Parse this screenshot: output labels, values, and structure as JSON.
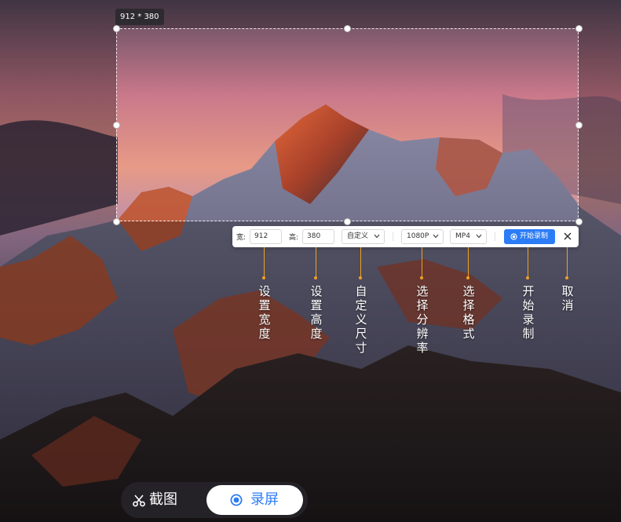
{
  "selection": {
    "size_label": "912 * 380"
  },
  "toolbar": {
    "width_label": "宽:",
    "width_value": "912",
    "height_label": "高:",
    "height_value": "380",
    "custom_label": "自定义",
    "resolution_value": "1080P",
    "format_value": "MP4",
    "record_label": "开始录制",
    "close_icon": "close-icon",
    "accent": "#2b7cf6"
  },
  "annotations": {
    "set_width": "设置宽度",
    "set_height": "设置高度",
    "custom_size": "自定义尺寸",
    "select_resolution": "选择分辨率",
    "select_format": "选择格式",
    "start_record": "开始录制",
    "cancel": "取消",
    "line_color": "#f0a020"
  },
  "mode_switch": {
    "screenshot_label": "截图",
    "record_label": "录屏",
    "active": "录屏",
    "screenshot_icon": "scissors-icon",
    "record_icon": "record-icon"
  }
}
